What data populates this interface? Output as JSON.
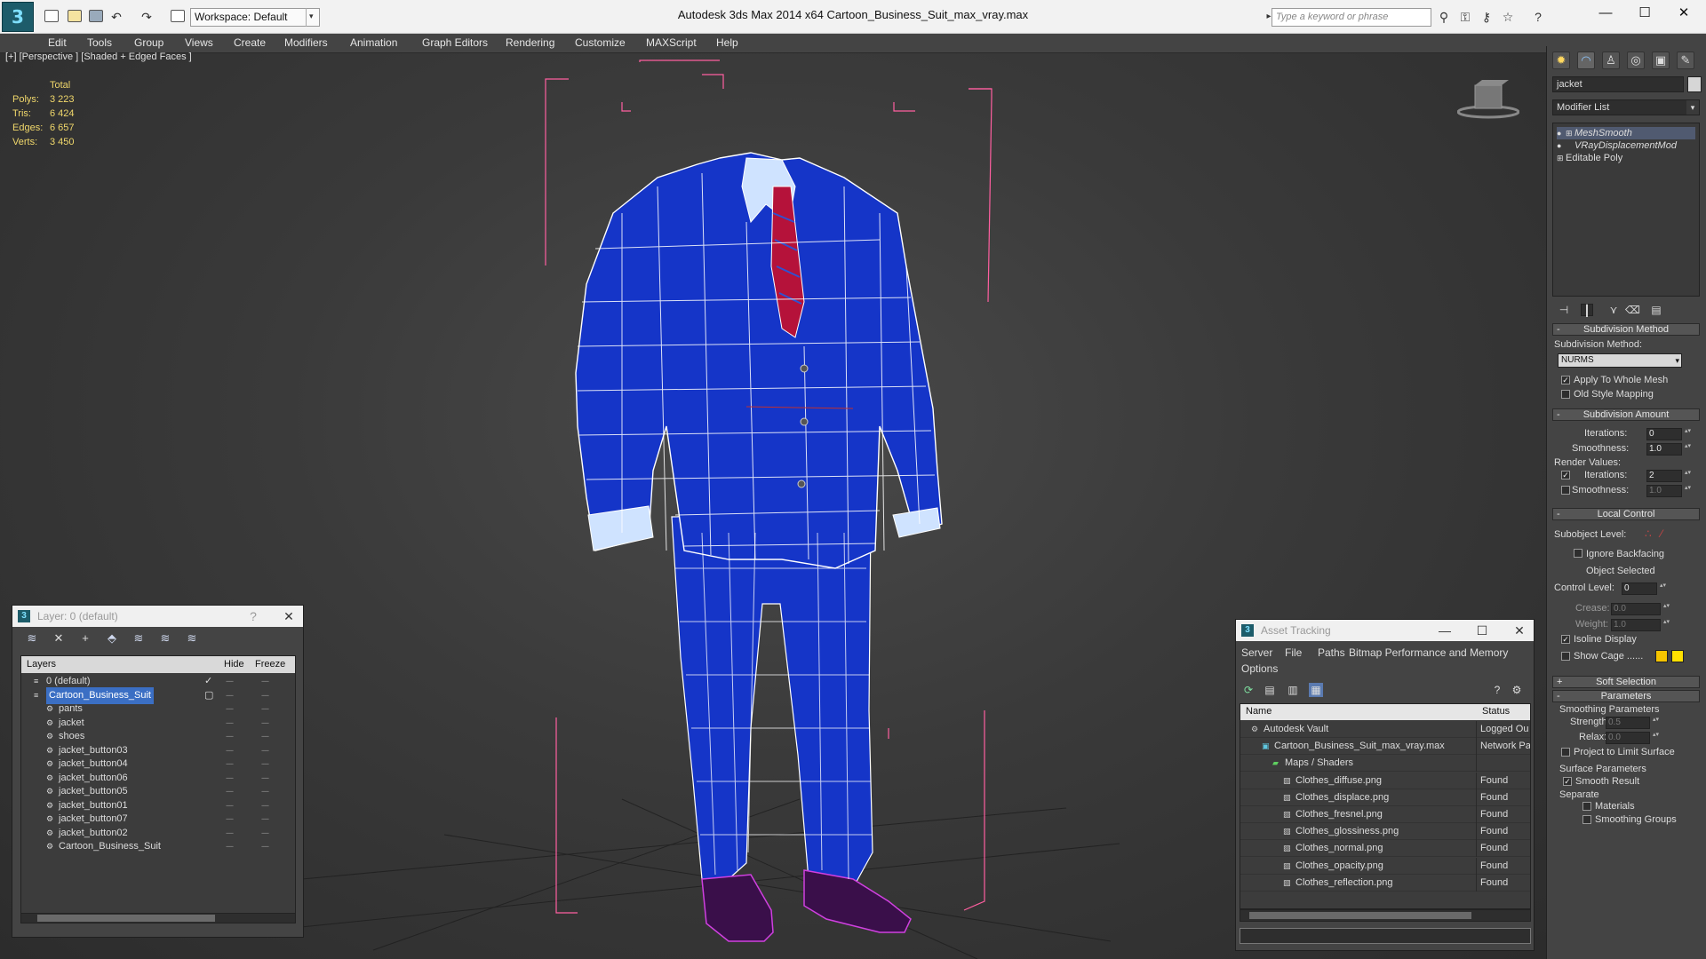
{
  "titlebar": {
    "workspace": "Workspace: Default",
    "title": "Autodesk 3ds Max  2014 x64      Cartoon_Business_Suit_max_vray.max",
    "search_placeholder": "Type a keyword or phrase"
  },
  "menu": [
    "Edit",
    "Tools",
    "Group",
    "Views",
    "Create",
    "Modifiers",
    "Animation",
    "Graph Editors",
    "Rendering",
    "Customize",
    "MAXScript",
    "Help"
  ],
  "viewport": {
    "label": "[+] [Perspective ] [Shaded + Edged Faces ]",
    "stats": {
      "total_label": "Total",
      "rows": [
        {
          "label": "Polys:",
          "value": "3 223"
        },
        {
          "label": "Tris:",
          "value": "6 424"
        },
        {
          "label": "Edges:",
          "value": "6 657"
        },
        {
          "label": "Verts:",
          "value": "3 450"
        }
      ]
    }
  },
  "command_panel": {
    "object_name": "jacket",
    "modifier_list": "Modifier List",
    "stack": [
      "MeshSmooth",
      "VRayDisplacementMod",
      "Editable Poly"
    ],
    "subdivision_method": {
      "header": "Subdivision Method",
      "label": "Subdivision Method:",
      "value": "NURMS",
      "apply_whole_mesh": "Apply To Whole Mesh",
      "old_style": "Old Style Mapping"
    },
    "subdivision_amount": {
      "header": "Subdivision Amount",
      "iterations_label": "Iterations:",
      "iterations": "0",
      "smoothness_label": "Smoothness:",
      "smoothness": "1.0",
      "render_values": "Render Values:",
      "r_iterations_label": "Iterations:",
      "r_iterations": "2",
      "r_smoothness_label": "Smoothness:",
      "r_smoothness": "1.0"
    },
    "local_control": {
      "header": "Local Control",
      "subobject_label": "Subobject Level:",
      "ignore_backfacing": "Ignore Backfacing",
      "object_selected": "Object Selected",
      "control_level_label": "Control Level:",
      "control_level": "0",
      "crease_label": "Crease:",
      "crease": "0.0",
      "weight_label": "Weight:",
      "weight": "1.0",
      "isoline": "Isoline Display",
      "show_cage": "Show Cage ......",
      "cage_color1": "#f5c400",
      "cage_color2": "#ffe000"
    },
    "soft_selection": "Soft Selection",
    "parameters": {
      "header": "Parameters",
      "smoothing_params": "Smoothing Parameters",
      "strength_label": "Strength:",
      "strength": "0.5",
      "relax_label": "Relax:",
      "relax": "0.0",
      "project_limit": "Project to Limit Surface",
      "surface_params": "Surface Parameters",
      "smooth_result": "Smooth Result",
      "separate": "Separate",
      "materials": "Materials",
      "smoothing_groups": "Smoothing Groups"
    }
  },
  "layer_window": {
    "title": "Layer: 0 (default)",
    "help": "?",
    "close": "✕",
    "columns": {
      "layers": "Layers",
      "hide": "Hide",
      "freeze": "Freeze"
    },
    "rows": [
      {
        "name": "0 (default)",
        "level": 1
      },
      {
        "name": "Cartoon_Business_Suit",
        "level": 1
      },
      {
        "name": "pants",
        "level": 2
      },
      {
        "name": "jacket",
        "level": 2
      },
      {
        "name": "shoes",
        "level": 2
      },
      {
        "name": "jacket_button03",
        "level": 2
      },
      {
        "name": "jacket_button04",
        "level": 2
      },
      {
        "name": "jacket_button06",
        "level": 2
      },
      {
        "name": "jacket_button05",
        "level": 2
      },
      {
        "name": "jacket_button01",
        "level": 2
      },
      {
        "name": "jacket_button07",
        "level": 2
      },
      {
        "name": "jacket_button02",
        "level": 2
      },
      {
        "name": "Cartoon_Business_Suit",
        "level": 2
      }
    ]
  },
  "asset_window": {
    "title": "Asset Tracking",
    "menu": [
      "Server",
      "File",
      "Paths",
      "Bitmap Performance and Memory",
      "Options"
    ],
    "columns": {
      "name": "Name",
      "status": "Status"
    },
    "rows": [
      {
        "name": "Autodesk Vault",
        "status": "Logged Ou",
        "level": 1
      },
      {
        "name": "Cartoon_Business_Suit_max_vray.max",
        "status": "Network Pa",
        "level": 2
      },
      {
        "name": "Maps / Shaders",
        "status": "",
        "level": 3
      },
      {
        "name": "Clothes_diffuse.png",
        "status": "Found",
        "level": 4
      },
      {
        "name": "Clothes_displace.png",
        "status": "Found",
        "level": 4
      },
      {
        "name": "Clothes_fresnel.png",
        "status": "Found",
        "level": 4
      },
      {
        "name": "Clothes_glossiness.png",
        "status": "Found",
        "level": 4
      },
      {
        "name": "Clothes_normal.png",
        "status": "Found",
        "level": 4
      },
      {
        "name": "Clothes_opacity.png",
        "status": "Found",
        "level": 4
      },
      {
        "name": "Clothes_reflection.png",
        "status": "Found",
        "level": 4
      }
    ]
  },
  "colors": {
    "suit": "#1535c8",
    "wire": "#ffffff",
    "bbox": "#ff5fa0",
    "shoes": "#b020c0",
    "selection": "#3b6fc4"
  }
}
